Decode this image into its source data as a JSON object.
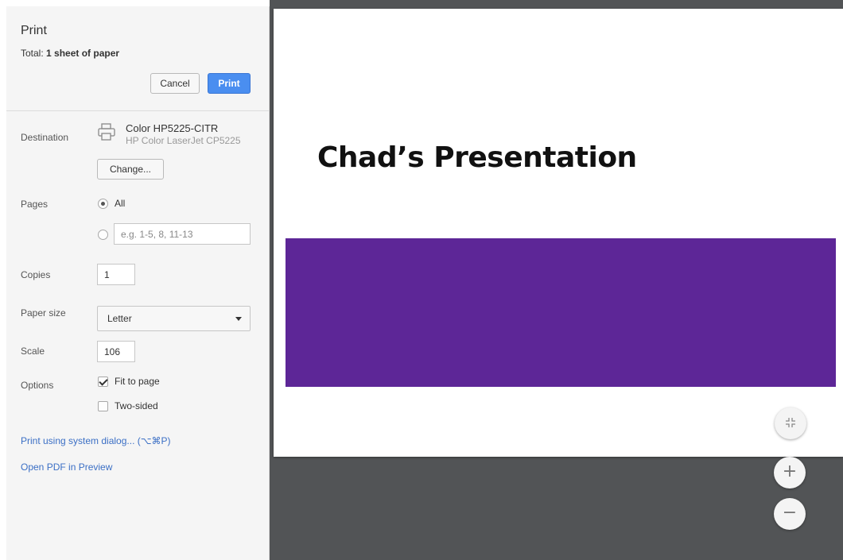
{
  "header": {
    "title": "Print",
    "total_prefix": "Total: ",
    "total_value": "1 sheet of paper",
    "cancel_label": "Cancel",
    "print_label": "Print"
  },
  "destination": {
    "label": "Destination",
    "icon": "printer-icon",
    "printer_name": "Color HP5225-CITR",
    "printer_model": "HP Color LaserJet CP5225",
    "change_label": "Change..."
  },
  "pages": {
    "label": "Pages",
    "all_label": "All",
    "range_placeholder": "e.g. 1-5, 8, 11-13"
  },
  "copies": {
    "label": "Copies",
    "value": "1"
  },
  "paper_size": {
    "label": "Paper size",
    "value": "Letter"
  },
  "scale": {
    "label": "Scale",
    "value": "106"
  },
  "options": {
    "label": "Options",
    "fit_to_page": "Fit to page",
    "fit_to_page_checked": true,
    "two_sided": "Two-sided",
    "two_sided_checked": false
  },
  "links": {
    "system_dialog": "Print using system dialog... (⌥⌘P)",
    "open_pdf": "Open PDF in Preview"
  },
  "preview": {
    "slide_title": "Chad’s Presentation",
    "band_color": "#5d2697",
    "fit_icon": "fit-to-page-icon",
    "zoom_in_icon": "+",
    "zoom_out_icon": "−"
  },
  "colors": {
    "print_button": "#4a8ef0",
    "link": "#3b6fc5",
    "preview_background": "#525456"
  }
}
